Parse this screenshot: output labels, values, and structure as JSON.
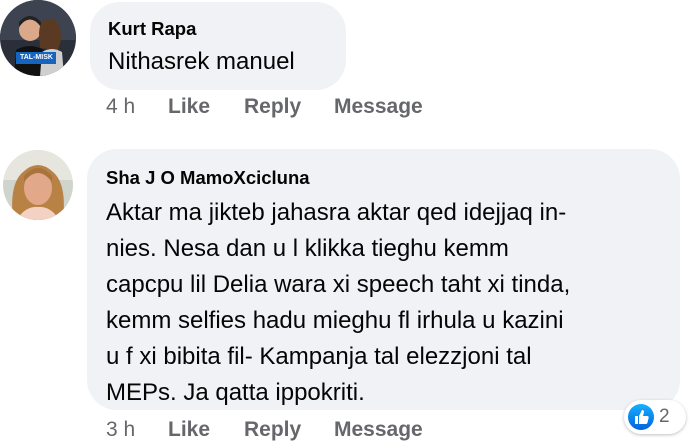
{
  "comments": [
    {
      "author": "Kurt Rapa",
      "text_lines": [
        "Nithasrek manuel"
      ],
      "avatar_badge": "TAL-MISK",
      "time": "4 h",
      "actions": [
        "Like",
        "Reply",
        "Message"
      ]
    },
    {
      "author": "Sha J O MamoXcicluna",
      "text_lines": [
        "Aktar ma jikteb jahasra aktar qed idejjaq in-",
        "nies. Nesa dan u l klikka tieghu kemm",
        "capcpu lil Delia wara xi speech taht xi tinda,",
        "kemm  selfies hadu mieghu fl irhula u kazini",
        "u f xi bibita fil- Kampanja tal elezzjoni tal",
        "MEPs. Ja qatta ippokriti."
      ],
      "time": "3 h",
      "actions": [
        "Like",
        "Reply",
        "Message"
      ],
      "reactions": {
        "icon": "like-icon",
        "count": "2"
      }
    }
  ],
  "colors": {
    "bubble": "#f0f2f5",
    "meta_text": "#65676b",
    "like_blue": "#1877f2"
  }
}
